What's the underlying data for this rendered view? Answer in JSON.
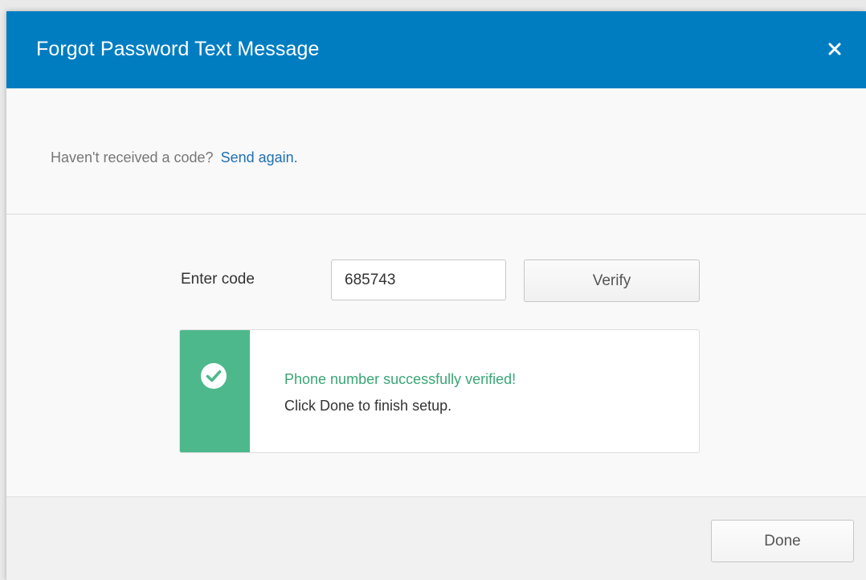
{
  "dialog": {
    "title": "Forgot Password Text Message",
    "close_icon": "close-icon"
  },
  "resend": {
    "prompt": "Haven't received a code?",
    "link_label": "Send again."
  },
  "verification": {
    "code_label": "Enter code",
    "code_value": "685743",
    "verify_label": "Verify"
  },
  "alert": {
    "icon": "check-circle-icon",
    "title": "Phone number successfully verified!",
    "detail": "Click Done to finish setup."
  },
  "footer": {
    "done_label": "Done"
  },
  "colors": {
    "header": "#007dc1",
    "link": "#1f6fb2",
    "success": "#4cb88c",
    "success_text": "#3aa676"
  }
}
